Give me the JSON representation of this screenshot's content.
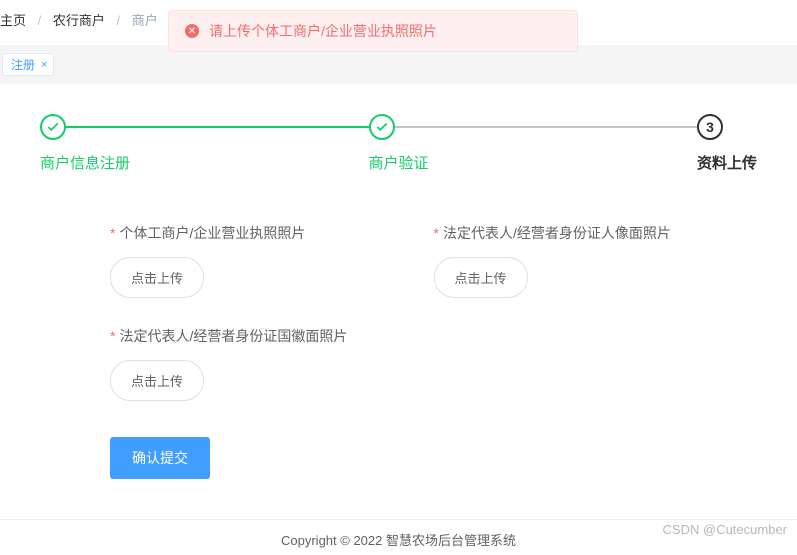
{
  "breadcrumb": {
    "item1": "主页",
    "item2": "农行商户",
    "item3": "商户"
  },
  "alert": {
    "message": "请上传个体工商户/企业营业执照照片"
  },
  "tag": {
    "label": "注册",
    "close": "×"
  },
  "steps": {
    "step1": "商户信息注册",
    "step2": "商户验证",
    "step3": "资料上传",
    "step3_num": "3"
  },
  "form": {
    "field1_label": "个体工商户/企业营业执照照片",
    "field2_label": "法定代表人/经营者身份证人像面照片",
    "field3_label": "法定代表人/经营者身份证国徽面照片",
    "upload_btn": "点击上传",
    "submit_btn": "确认提交"
  },
  "footer": {
    "copyright": "Copyright © 2022 智慧农场后台管理系统"
  },
  "watermark": "CSDN @Cutecumber"
}
